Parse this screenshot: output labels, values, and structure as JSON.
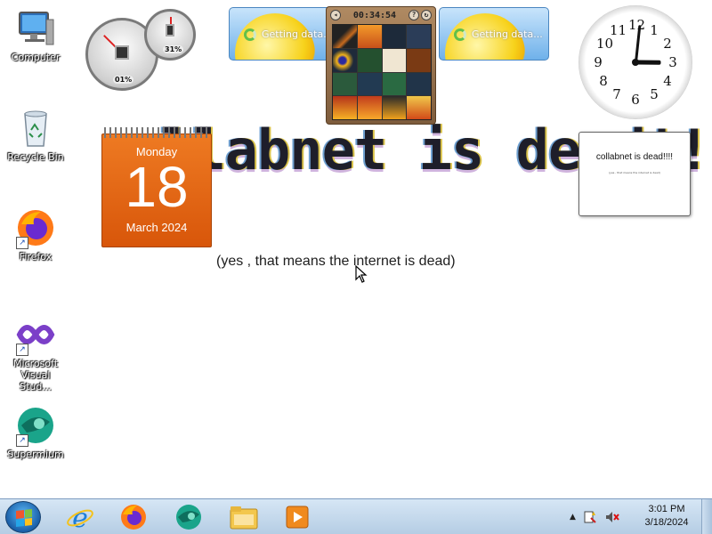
{
  "desktop": {
    "icons": [
      {
        "label": "Computer",
        "icon": "computer-icon"
      },
      {
        "label": "Recycle Bin",
        "icon": "recycle-bin-icon"
      },
      {
        "label": "Firefox",
        "icon": "firefox-icon"
      },
      {
        "label": "Microsoft Visual Stud...",
        "icon": "visual-studio-icon"
      },
      {
        "label": "Supermium",
        "icon": "supermium-icon"
      }
    ],
    "wallpaper_text": "llabnet is dead!!!",
    "wallpaper_subtext": "(yes , that means the internet is dead)"
  },
  "gadgets": {
    "calendar": {
      "day": "Monday",
      "date": "18",
      "month_year": "March 2024",
      "accent": "#e36b14"
    },
    "cpu_meter": {
      "cpu": "01%",
      "memory": "31%"
    },
    "weather": [
      {
        "status": "Getting data..."
      },
      {
        "status": "Getting data..."
      }
    ],
    "puzzle": {
      "timer": "00:34:54"
    },
    "clock": {
      "numbers": [
        "12",
        "1",
        "2",
        "3",
        "4",
        "5",
        "6",
        "7",
        "8",
        "9",
        "10",
        "11"
      ],
      "hour": 3,
      "minute": 1
    },
    "note": {
      "title": "collabnet is dead!!!!",
      "subtitle": "(yes , that means the internet is dead)"
    }
  },
  "taskbar": {
    "apps": [
      {
        "icon": "internet-explorer-icon"
      },
      {
        "icon": "firefox-icon"
      },
      {
        "icon": "supermium-icon"
      },
      {
        "icon": "file-explorer-icon"
      },
      {
        "icon": "media-player-icon"
      }
    ],
    "time": "3:01 PM",
    "date": "3/18/2024"
  },
  "colors": {
    "taskbar": "#c4d8ec",
    "calendar": "#e36b14",
    "weather": "#6fb1ea"
  }
}
